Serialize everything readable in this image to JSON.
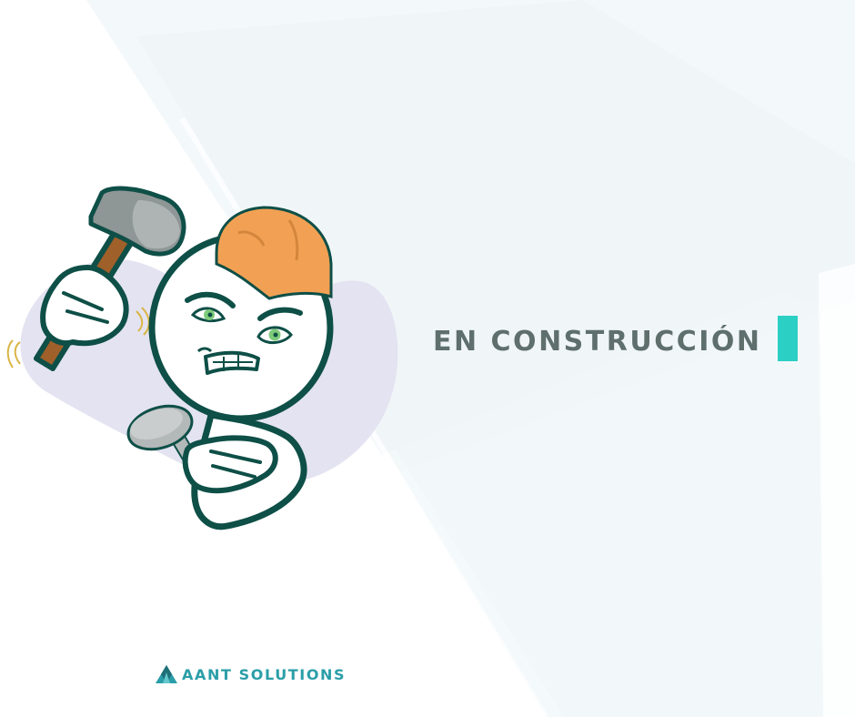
{
  "headline": {
    "text": "EN CONSTRUCCIÓN",
    "color": "#5f6f6c"
  },
  "accent_color": "#2ccfc4",
  "brand": {
    "name": "AANT SOLUTIONS",
    "color": "#2a9ea8",
    "logo_icon": "mountain-triangle-icon"
  },
  "illustration": {
    "description_icon": "construction-mascot-illustration",
    "parts": [
      "hard-hat-icon",
      "hammer-icon",
      "nail-icon"
    ],
    "colors": {
      "hat": "#f2a154",
      "outline": "#0e4f47",
      "eyes": "#7ecb7a",
      "hammer_head": "#8f9696",
      "hammer_handle": "#a0602a",
      "nail": "#b3b8b8",
      "blob": "#e4e3f1"
    }
  }
}
